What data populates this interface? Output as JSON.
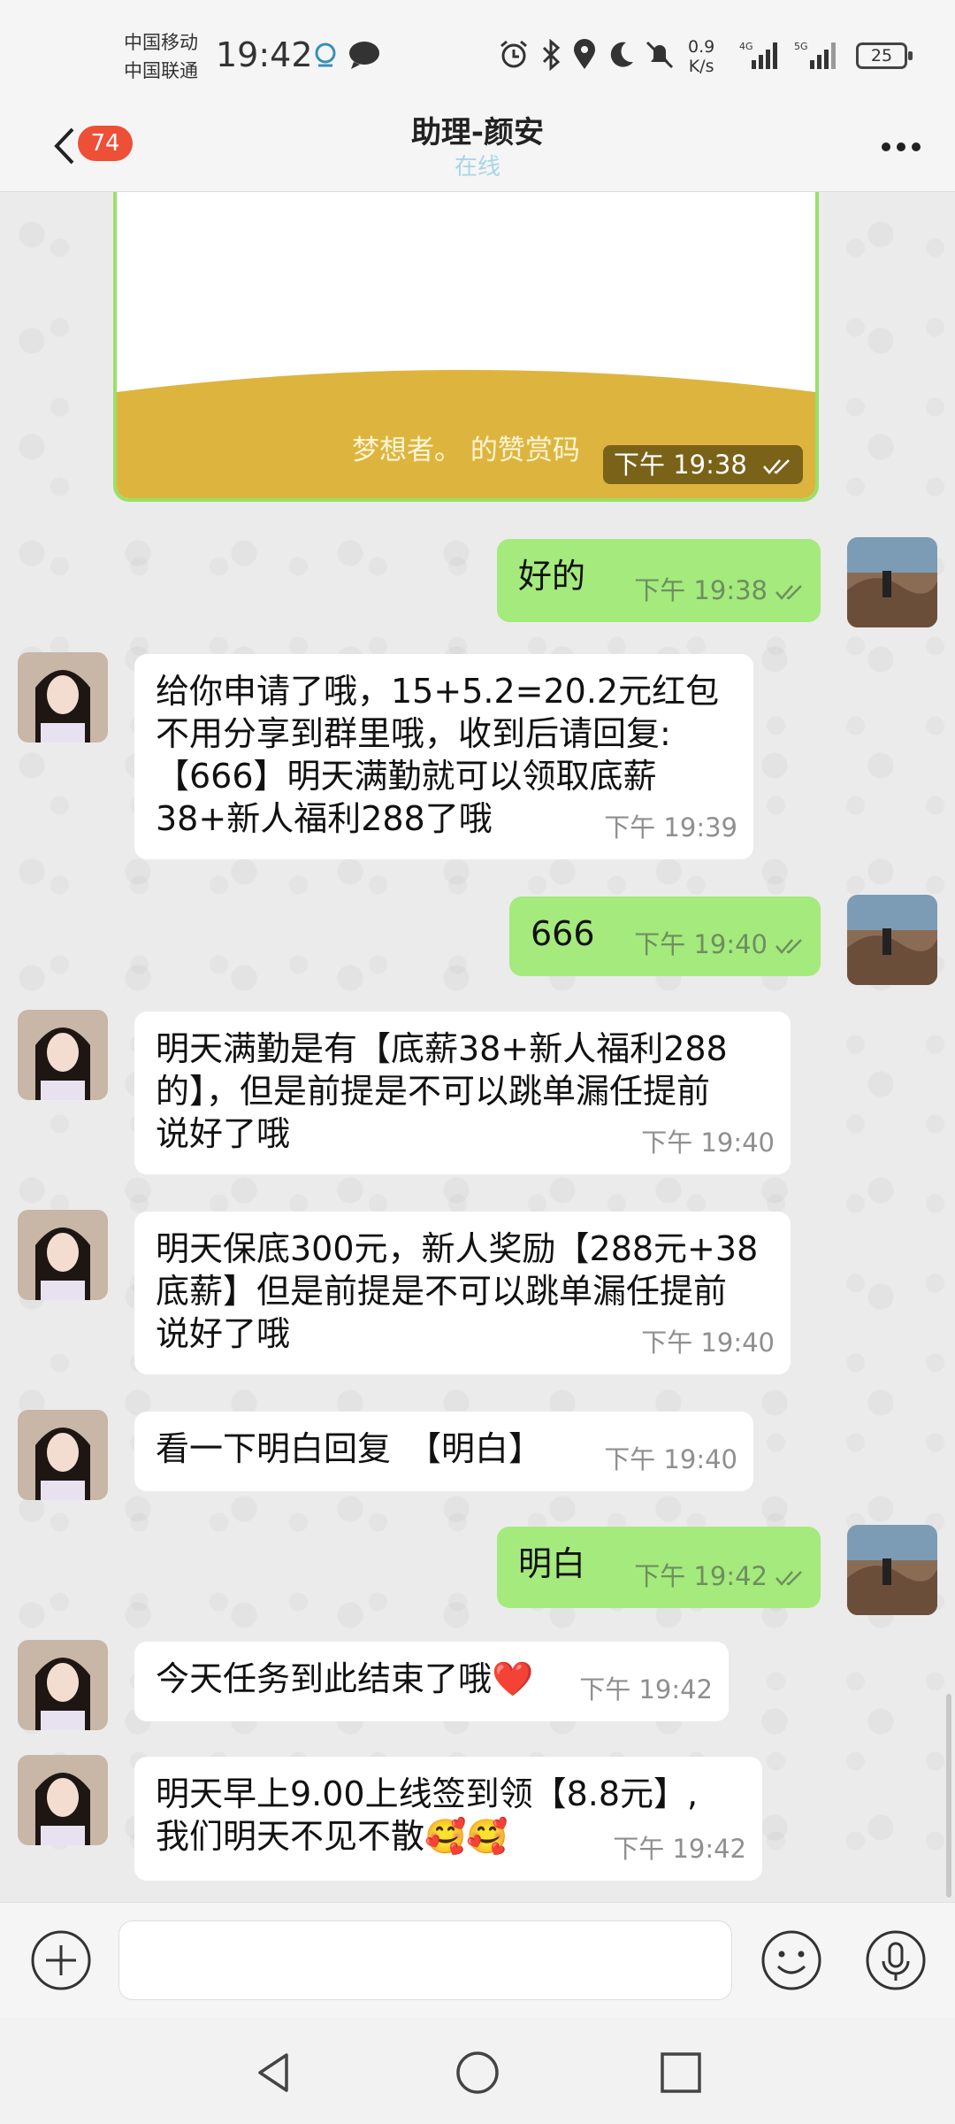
{
  "status_bar": {
    "carrier1": "中国移动",
    "carrier2": "中国联通",
    "time": "19:42",
    "net_speed_value": "0.9",
    "net_speed_unit": "K/s",
    "signal1": "4G",
    "signal2": "5G",
    "battery": "25",
    "icons": [
      "app-notification-icon",
      "chat-bubble-icon",
      "alarm-icon",
      "bluetooth-icon",
      "location-icon",
      "moon-icon",
      "mute-bell-icon"
    ]
  },
  "header": {
    "unread_count": "74",
    "title": "助理-颜安",
    "status": "在线"
  },
  "reward_card": {
    "caption": "梦想者。 的赞赏码",
    "time": "下午 19:38"
  },
  "messages": [
    {
      "side": "out",
      "text": "好的",
      "time": "下午 19:38"
    },
    {
      "side": "in",
      "lines": [
        "给你申请了哦，15+5.2=20.2元红包",
        "不用分享到群里哦，收到后请回复:",
        "【666】明天满勤就可以领取底薪",
        "38+新人福利288了哦"
      ],
      "time": "下午 19:39"
    },
    {
      "side": "out",
      "text": "666",
      "time": "下午 19:40"
    },
    {
      "side": "in",
      "lines": [
        "明天满勤是有【底薪38+新人福利288",
        "的】，但是前提是不可以跳单漏任提前",
        "说好了哦"
      ],
      "time": "下午 19:40"
    },
    {
      "side": "in",
      "lines": [
        "明天保底300元，新人奖励【288元+38",
        "底薪】但是前提是不可以跳单漏任提前",
        "说好了哦"
      ],
      "time": "下午 19:40"
    },
    {
      "side": "in",
      "text": "看一下明白回复　【明白】",
      "time": "下午 19:40"
    },
    {
      "side": "out",
      "text": "明白",
      "time": "下午 19:42"
    },
    {
      "side": "in",
      "text": "今天任务到此结束了哦❤️",
      "time": "下午 19:42"
    },
    {
      "side": "in",
      "lines": [
        "明天早上9.00上线签到领【8.8元】,",
        "我们明天不见不散🥰🥰"
      ],
      "time": "下午 19:42"
    }
  ],
  "input_bar": {
    "placeholder": ""
  },
  "colors": {
    "outgoing_bubble": "#a5ea7d",
    "incoming_bubble": "#ffffff",
    "unread_badge": "#ee4f37",
    "card_yellow": "#ddb53e"
  }
}
